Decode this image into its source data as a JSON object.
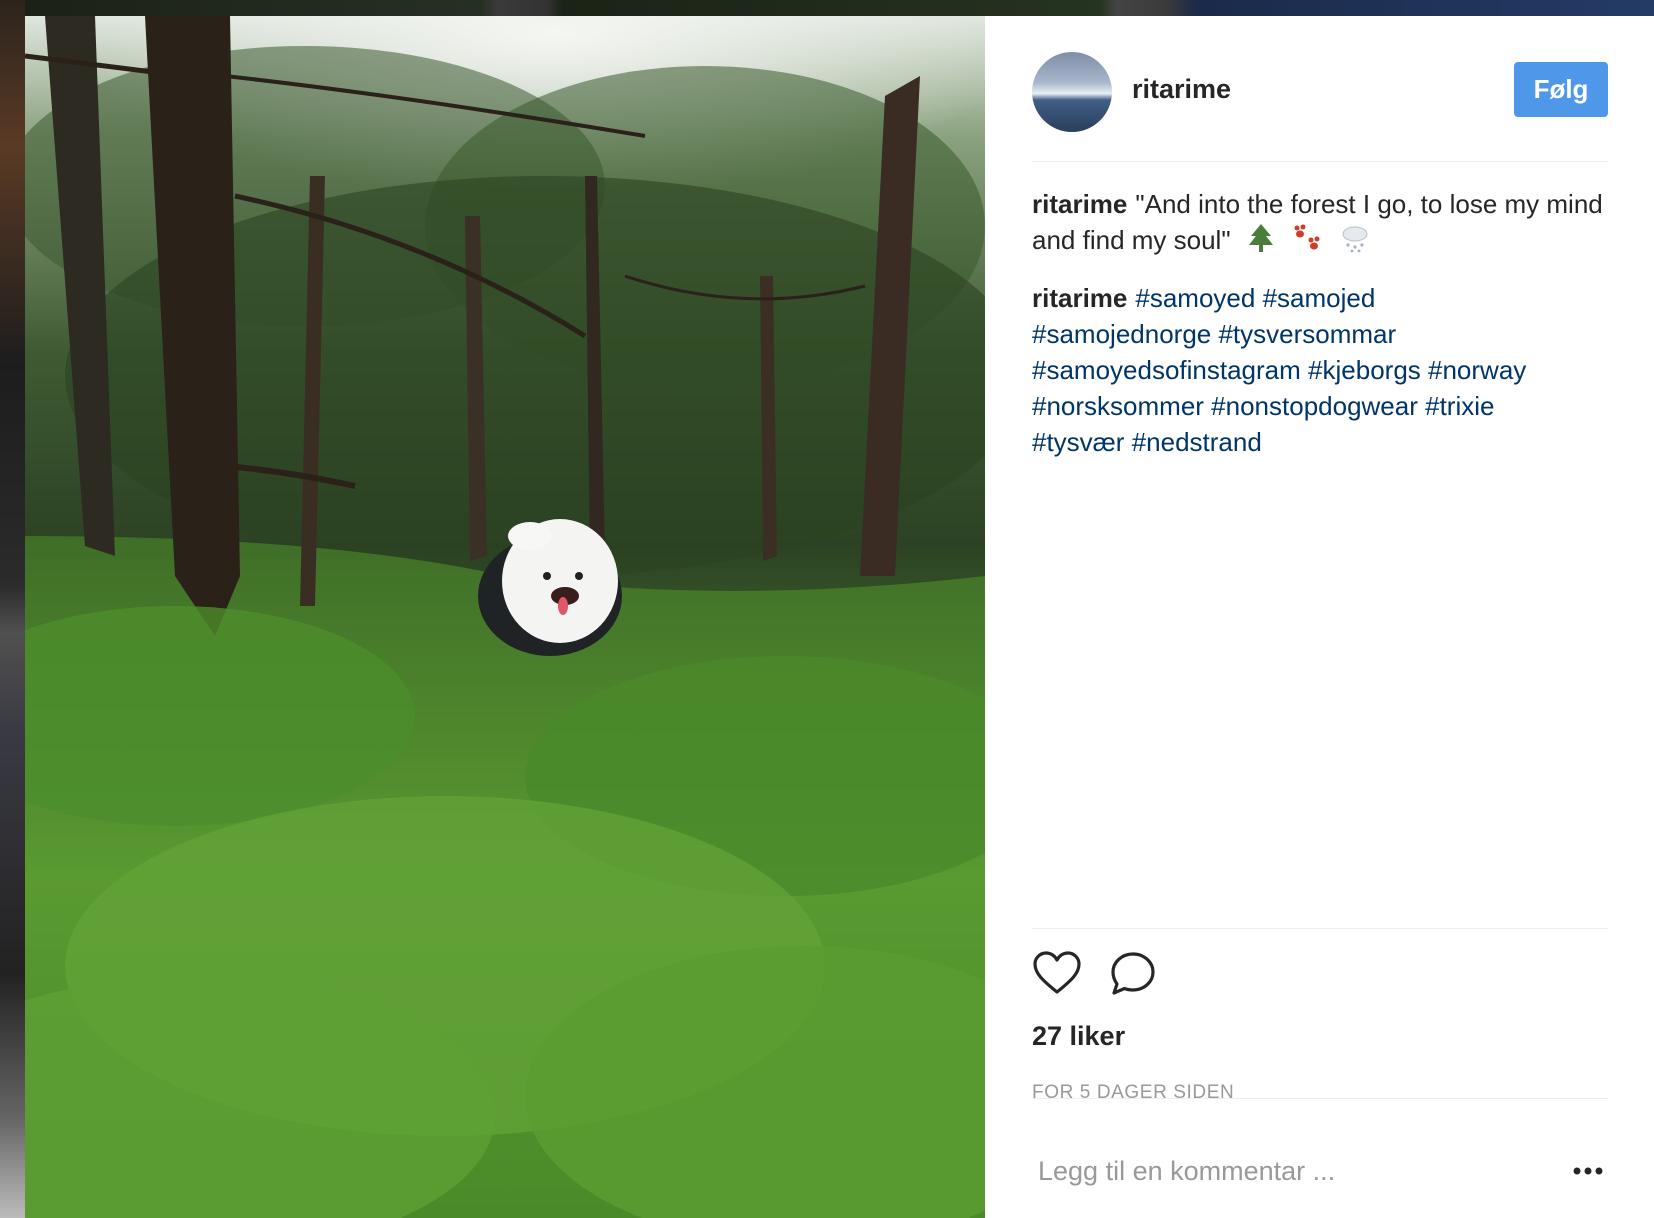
{
  "post": {
    "username": "ritarime",
    "follow_label": "Følg",
    "caption": {
      "username": "ritarime",
      "text": "\"And into the forest I go, to lose my mind and find my soul\"",
      "emoji_icons": [
        "evergreen-tree-icon",
        "paw-prints-icon",
        "cloud-snow-icon"
      ]
    },
    "hashtag_comment": {
      "username": "ritarime",
      "tags": [
        "#samoyed",
        "#samojed",
        "#samojednorge",
        "#tysversommar",
        "#samoyedsofinstagram",
        "#kjeborgs",
        "#norway",
        "#norsksommer",
        "#nonstopdogwear",
        "#trixie",
        "#tysvær",
        "#nedstrand"
      ]
    },
    "likes_text": "27 liker",
    "timestamp": "FOR 5 DAGER SIDEN",
    "comment_placeholder": "Legg til en kommentar ...",
    "more_icon": "more-options-icon",
    "action_icons": [
      "heart-icon",
      "comment-icon"
    ]
  },
  "colors": {
    "follow_button": "#4f98e9",
    "hashtag": "#003569",
    "username": "#262626",
    "muted": "#999999"
  }
}
